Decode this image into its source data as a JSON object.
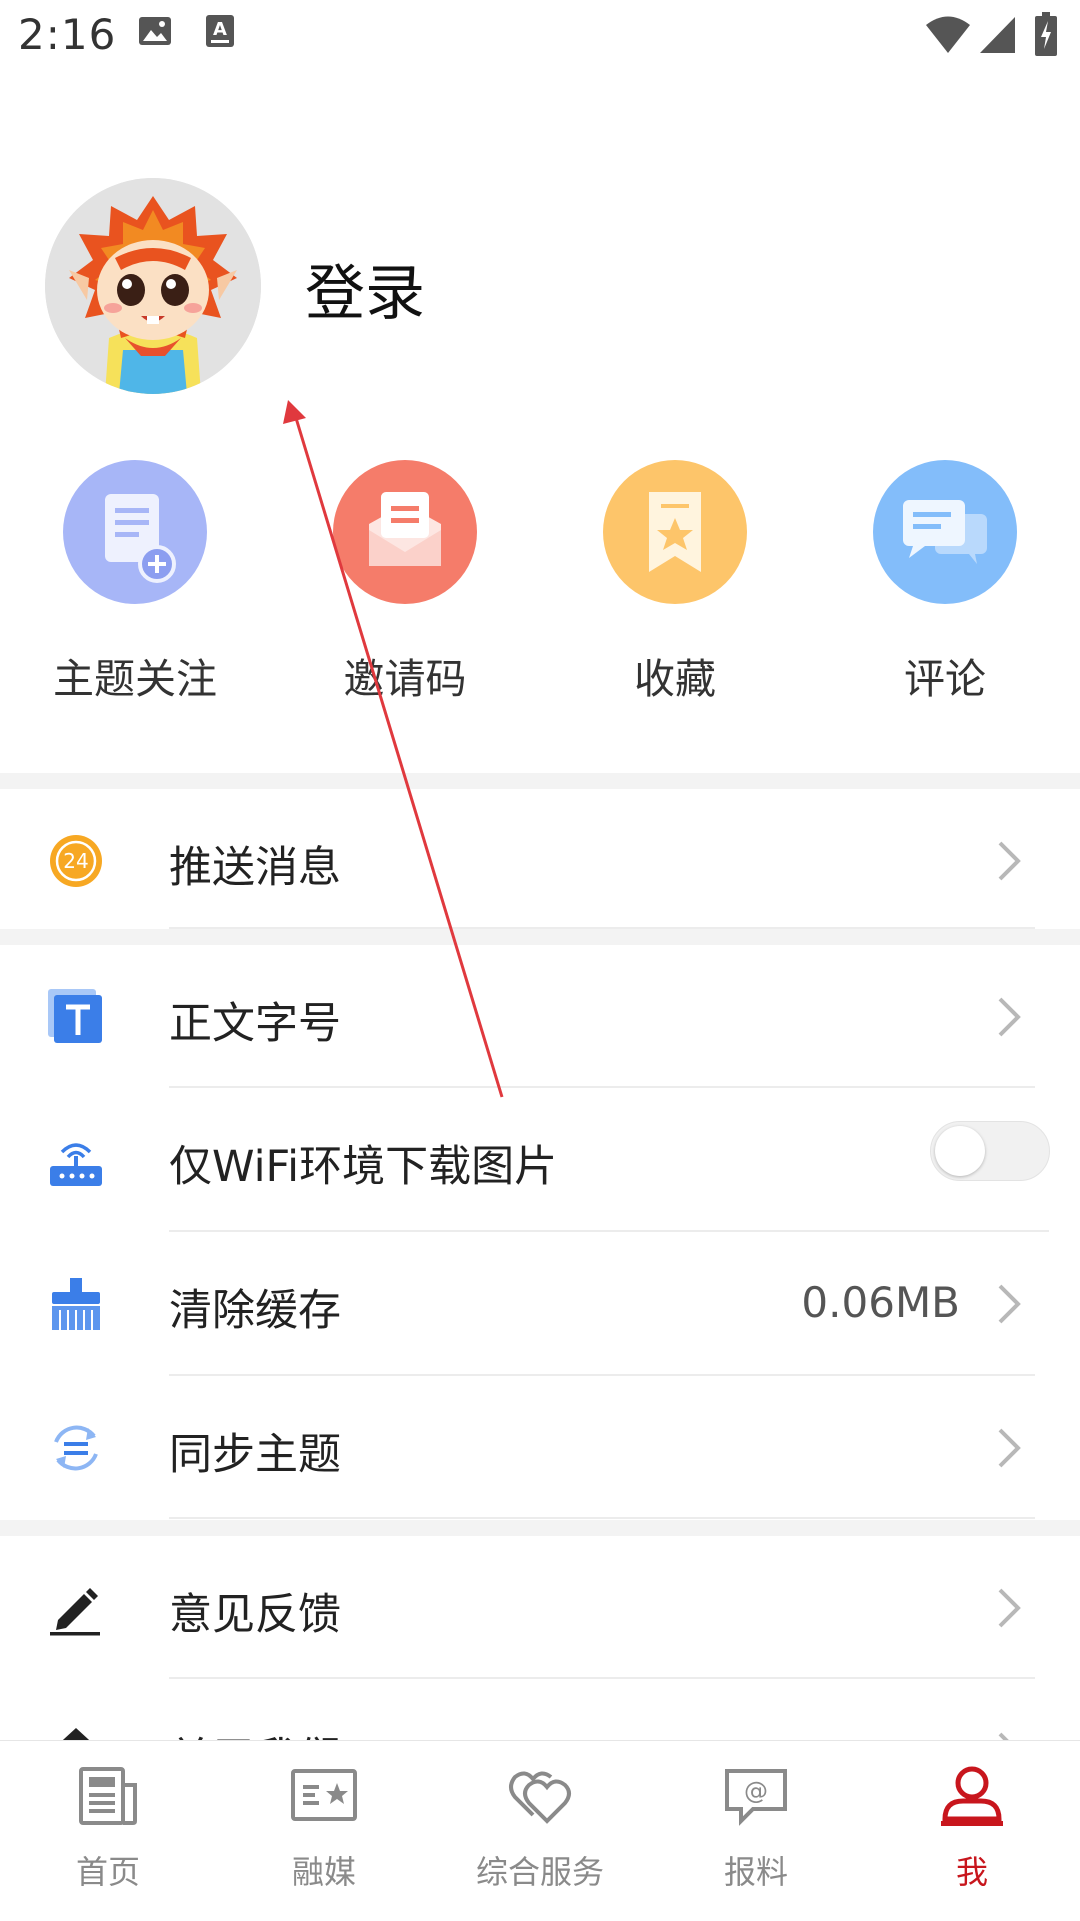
{
  "status_bar": {
    "time": "2:16"
  },
  "profile": {
    "login_label": "登录"
  },
  "quick_actions": [
    {
      "label": "主题关注",
      "icon": "topic-follow-icon",
      "color": "#a7b6f7"
    },
    {
      "label": "邀请码",
      "icon": "invite-code-icon",
      "color": "#f57c6a"
    },
    {
      "label": "收藏",
      "icon": "bookmark-icon",
      "color": "#fdc56a"
    },
    {
      "label": "评论",
      "icon": "comment-icon",
      "color": "#83bdfa"
    }
  ],
  "menu": {
    "push": {
      "label": "推送消息",
      "badge": "24"
    },
    "font_size": {
      "label": "正文字号"
    },
    "wifi_images": {
      "label": "仅WiFi环境下载图片",
      "enabled": false
    },
    "clear_cache": {
      "label": "清除缓存",
      "value": "0.06MB"
    },
    "sync_topics": {
      "label": "同步主题"
    },
    "feedback": {
      "label": "意见反馈"
    },
    "about": {
      "label": "关于我们"
    }
  },
  "bottom_nav": [
    {
      "label": "首页",
      "icon": "newspaper-icon",
      "active": false
    },
    {
      "label": "融媒",
      "icon": "media-card-icon",
      "active": false
    },
    {
      "label": "综合服务",
      "icon": "hearts-icon",
      "active": false
    },
    {
      "label": "报料",
      "icon": "report-chat-icon",
      "active": false
    },
    {
      "label": "我",
      "icon": "user-icon",
      "active": true
    }
  ],
  "colors": {
    "accent": "#c8161d",
    "gap": "#f3f3f3",
    "arrow": "#e0393e"
  }
}
